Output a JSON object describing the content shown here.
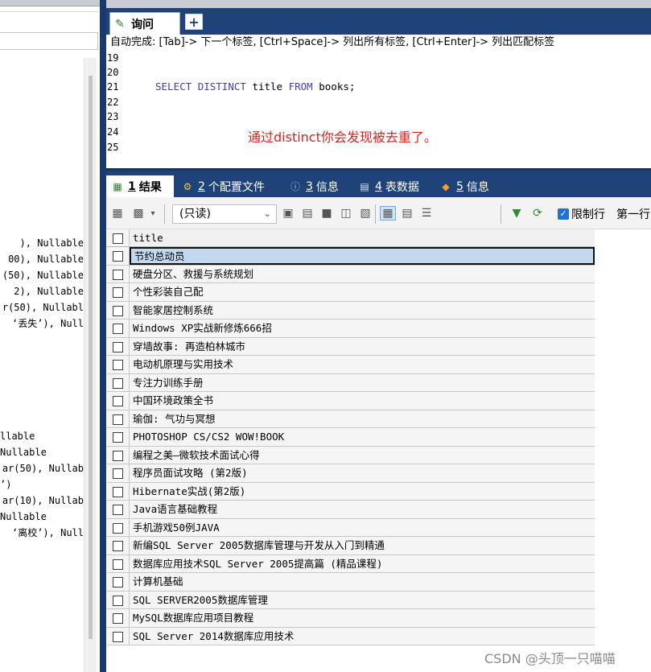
{
  "left_panel": {
    "lines": [
      {
        "text": "), Nullable"
      },
      {
        "text": "00), Nullable"
      },
      {
        "text": "(50), Nullable"
      },
      {
        "text": " 2), Nullable"
      },
      {
        "text": "r(50), Nullabl"
      },
      {
        "text": "‘丢失’), Null"
      },
      {
        "text": "llable"
      },
      {
        "text": " Nullable"
      },
      {
        "text": "ar(50), Nullab"
      },
      {
        "text": "’)"
      },
      {
        "text": "ar(10), Nullab"
      },
      {
        "text": "  Nullable"
      },
      {
        "text": "‘离校’), Null"
      }
    ]
  },
  "query_tab": {
    "label": "询问",
    "add_label": "+"
  },
  "editor": {
    "autocomplete_hint": "自动完成: [Tab]-> 下一个标签, [Ctrl+Space]-> 列出所有标签, [Ctrl+Enter]-> 列出匹配标签",
    "line_numbers": [
      "19",
      "20",
      "21",
      "22",
      "23",
      "24",
      "25"
    ],
    "code": {
      "kw1": "SELECT",
      "kw2": "DISTINCT",
      "ident": "title",
      "kw3": "FROM",
      "table": "books;"
    },
    "annotation": "通过distinct你会发现被去重了。"
  },
  "results_tabs": [
    {
      "num": "1",
      "label": "结果",
      "icon": "grid-icon"
    },
    {
      "num": "2",
      "label": "个配置文件",
      "icon": "profile-icon"
    },
    {
      "num": "3",
      "label": "信息",
      "icon": "info-icon"
    },
    {
      "num": "4",
      "label": "表数据",
      "icon": "table-icon"
    },
    {
      "num": "5",
      "label": "信息",
      "icon": "info-color-icon"
    }
  ],
  "toolbar": {
    "readonly_value": "(只读)",
    "limit_rows_label": "限制行",
    "first_row_label": "第一行"
  },
  "grid": {
    "column": "title",
    "rows": [
      "节约总动员",
      "硬盘分区、救援与系统规划",
      "个性彩装自己配",
      "智能家居控制系统",
      "Windows XP实战新修炼666招",
      "穿墙故事: 再造柏林城市",
      "电动机原理与实用技术",
      "专注力训练手册",
      "中国环境政策全书",
      "瑜伽: 气功与冥想",
      "PHOTOSHOP CS/CS2 WOW!BOOK",
      "编程之美—微软技术面试心得",
      "程序员面试攻略 (第2版)",
      "Hibernate实战(第2版)",
      "Java语言基础教程",
      "手机游戏50例JAVA",
      "新编SQL Server 2005数据库管理与开发从入门到精通",
      "数据库应用技术SQL Server 2005提高篇 (精品课程)",
      "计算机基础",
      "SQL SERVER2005数据库管理",
      "MySQL数据库应用项目教程",
      "SQL Server 2014数据库应用技术"
    ],
    "selected_index": 0
  },
  "watermark": "CSDN @头顶一只喵喵"
}
